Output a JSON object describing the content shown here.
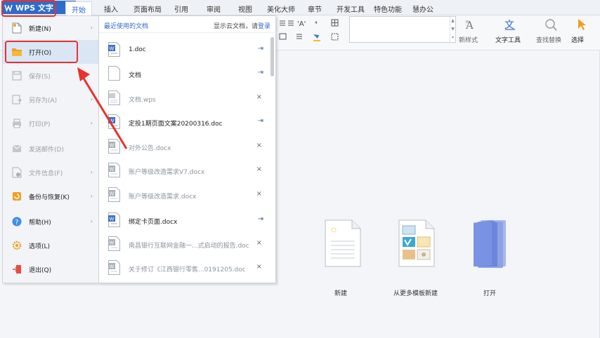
{
  "app": {
    "name": "WPS 文字"
  },
  "menubar": {
    "tabs": [
      "开始",
      "插入",
      "页面布局",
      "引用",
      "审阅",
      "视图",
      "美化大师",
      "章节",
      "开发工具",
      "特色功能",
      "慧办公"
    ]
  },
  "ribbon": {
    "new_style": "新样式",
    "text_tools": "文字工具",
    "find_replace": "查找替换",
    "select": "选择"
  },
  "file_menu": {
    "items": [
      {
        "label": "新建(N)",
        "icon": "new-doc-icon",
        "submenu": true,
        "enabled": true
      },
      {
        "label": "打开(O)",
        "icon": "open-folder-icon",
        "submenu": false,
        "enabled": true
      },
      {
        "label": "保存(S)",
        "icon": "save-icon",
        "submenu": false,
        "enabled": false
      },
      {
        "label": "另存为(A)",
        "icon": "save-as-icon",
        "submenu": true,
        "enabled": false
      },
      {
        "label": "打印(P)",
        "icon": "print-icon",
        "submenu": true,
        "enabled": false
      },
      {
        "label": "发送邮件(D)",
        "icon": "mail-icon",
        "submenu": false,
        "enabled": false
      },
      {
        "label": "文件信息(F)",
        "icon": "file-info-icon",
        "submenu": true,
        "enabled": false
      },
      {
        "label": "备份与恢复(K)",
        "icon": "backup-icon",
        "submenu": true,
        "enabled": true
      },
      {
        "label": "帮助(H)",
        "icon": "help-icon",
        "submenu": true,
        "enabled": true
      },
      {
        "label": "选项(L)",
        "icon": "options-icon",
        "submenu": false,
        "enabled": true
      },
      {
        "label": "退出(Q)",
        "icon": "exit-icon",
        "submenu": false,
        "enabled": true
      }
    ]
  },
  "recent": {
    "title": "最近使用的文档",
    "cloud_prefix": "显示云文档，请",
    "cloud_link": "登录",
    "files": [
      {
        "name": "1.doc",
        "type": "word",
        "pinned": true,
        "dim": false
      },
      {
        "name": "文档",
        "type": "blank",
        "pinned": true,
        "dim": false
      },
      {
        "name": "文档.wps",
        "type": "wps",
        "pinned": false,
        "dim": true
      },
      {
        "name": "定投1期页面文案20200316.doc",
        "type": "word",
        "pinned": true,
        "dim": false
      },
      {
        "name": "对外公告.docx",
        "type": "word-gray",
        "pinned": false,
        "dim": true
      },
      {
        "name": "账户等级改造需求V7.docx",
        "type": "word-gray",
        "pinned": false,
        "dim": true
      },
      {
        "name": "账户等级改造需求.docx",
        "type": "word-gray",
        "pinned": false,
        "dim": true
      },
      {
        "name": "绑定卡页面.docx",
        "type": "word",
        "pinned": true,
        "dim": false
      },
      {
        "name": "南昌银行互联网金融一...式启动的报告.doc",
        "type": "word-gray",
        "pinned": false,
        "dim": true
      },
      {
        "name": "关于修订《江西银行零售...0191205.doc",
        "type": "word-gray",
        "pinned": false,
        "dim": true
      }
    ]
  },
  "start": {
    "new_label": "新建",
    "template_label": "从更多模板新建",
    "open_label": "打开"
  },
  "colors": {
    "accent": "#2f6bc9",
    "annotation": "#e8322e"
  }
}
